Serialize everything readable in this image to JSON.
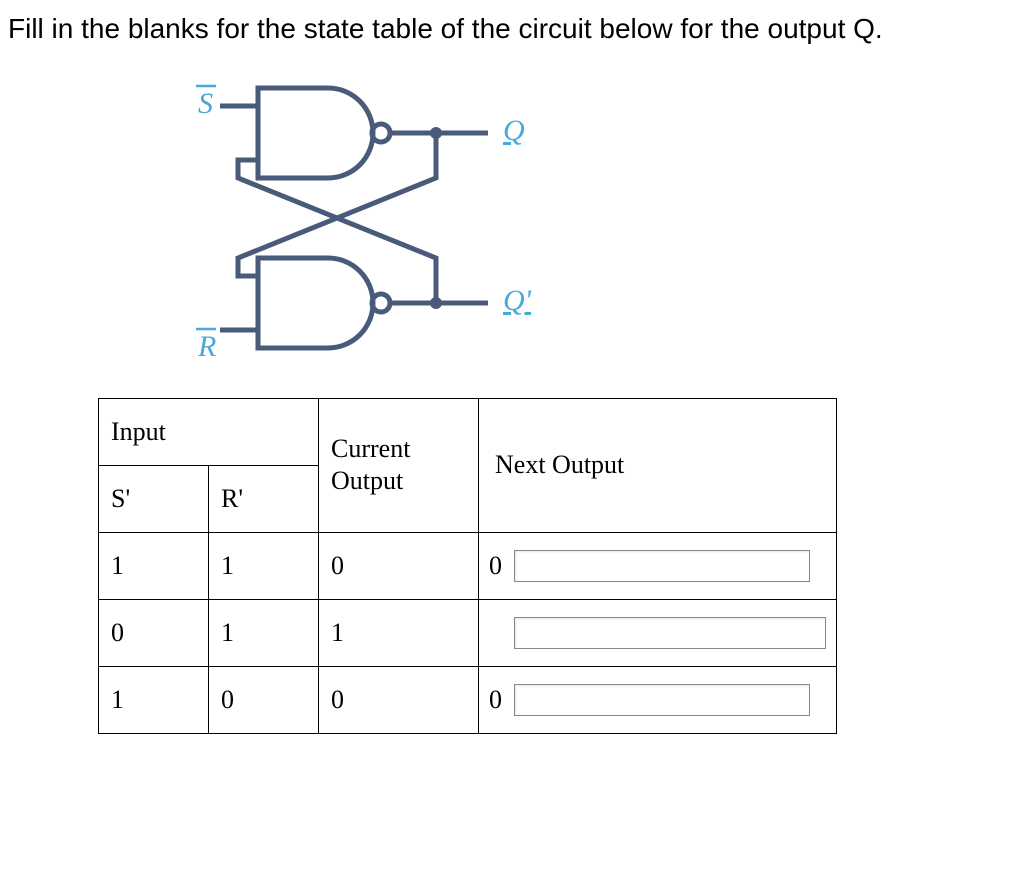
{
  "prompt": "Fill in the blanks for the state table of the circuit below for the output Q.",
  "circuit": {
    "input_top": "S",
    "input_bottom": "R",
    "output_top": "Q",
    "output_bottom": "Q'"
  },
  "table": {
    "headers": {
      "input": "Input",
      "s": "S'",
      "r": "R'",
      "current_output_line1": "Current",
      "current_output_line2": "Output",
      "next_output": "Next Output"
    },
    "rows": [
      {
        "s": "1",
        "r": "1",
        "current": "0",
        "next_value": "0",
        "next_input": ""
      },
      {
        "s": "0",
        "r": "1",
        "current": "1",
        "next_value": "",
        "next_input": ""
      },
      {
        "s": "1",
        "r": "0",
        "current": "0",
        "next_value": "0",
        "next_input": ""
      }
    ]
  }
}
